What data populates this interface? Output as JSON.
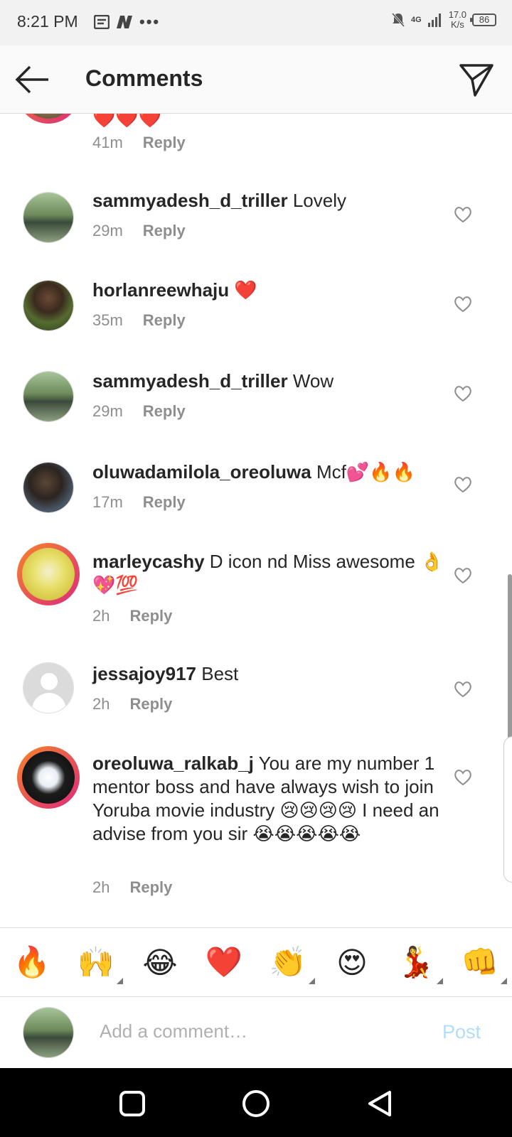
{
  "status_bar": {
    "time": "8:21 PM",
    "network": "4G",
    "speed_value": "17.0",
    "speed_unit": "K/s",
    "battery": "86"
  },
  "header": {
    "title": "Comments"
  },
  "comments": [
    {
      "username": "",
      "text": "❤️❤️❤️",
      "time": "41m",
      "reply": "Reply"
    },
    {
      "username": "sammyadesh_d_triller",
      "text": " Lovely",
      "time": "29m",
      "reply": "Reply"
    },
    {
      "username": "horlanreewhaju",
      "text": " ❤️",
      "time": "35m",
      "reply": "Reply"
    },
    {
      "username": "sammyadesh_d_triller",
      "text": " Wow",
      "time": "29m",
      "reply": "Reply"
    },
    {
      "username": "oluwadamilola_oreoluwa",
      "text": " Mcf💕🔥🔥",
      "time": "17m",
      "reply": "Reply"
    },
    {
      "username": "marleycashy",
      "text": " D icon nd Miss awesome 👌💖💯",
      "time": "2h",
      "reply": "Reply"
    },
    {
      "username": "jessajoy917",
      "text": " Best",
      "time": "2h",
      "reply": "Reply"
    },
    {
      "username": "oreoluwa_ralkab_j",
      "text": " You are my number 1 mentor boss and have always wish to join Yoruba movie industry 😢😢😢😢 I need an advise from you sir 😭😭😭😭😭",
      "time": "2h",
      "reply": "Reply"
    }
  ],
  "emoji_bar": [
    "🔥",
    "🙌",
    "😂",
    "❤️",
    "👏",
    "😍",
    "💃",
    "👊"
  ],
  "comment_input": {
    "placeholder": "Add a comment…",
    "post_label": "Post"
  },
  "colors": {
    "story_ring_start": "#f58529",
    "story_ring_end": "#dd2a7b",
    "post_disabled": "#b3dbff",
    "muted": "#8e8e8e"
  }
}
